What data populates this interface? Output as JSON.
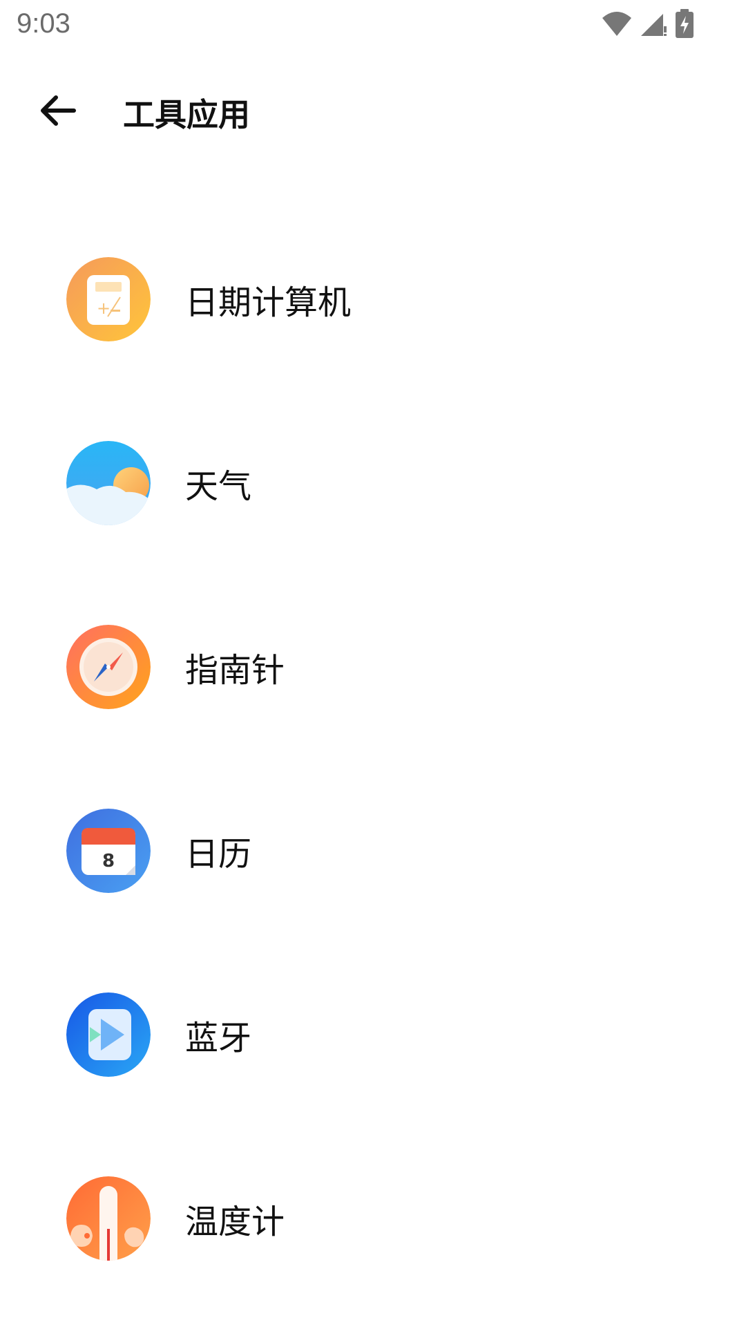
{
  "status_bar": {
    "time": "9:03",
    "icons": [
      "wifi-icon",
      "signal-icon",
      "battery-charging-icon"
    ]
  },
  "header": {
    "title": "工具应用",
    "back_icon": "arrow-left-icon"
  },
  "apps": [
    {
      "label": "日期计算机",
      "icon": "date-calculator-icon",
      "color": "#f7a24a"
    },
    {
      "label": "天气",
      "icon": "weather-icon",
      "color": "#2da8f5"
    },
    {
      "label": "指南针",
      "icon": "compass-icon",
      "color": "#ff7a4a"
    },
    {
      "label": "日历",
      "icon": "calendar-icon",
      "color": "#3d7de8"
    },
    {
      "label": "蓝牙",
      "icon": "bluetooth-icon",
      "color": "#1565e8"
    },
    {
      "label": "温度计",
      "icon": "thermometer-icon",
      "color": "#ff7a2e"
    }
  ],
  "calendar_day": "8"
}
